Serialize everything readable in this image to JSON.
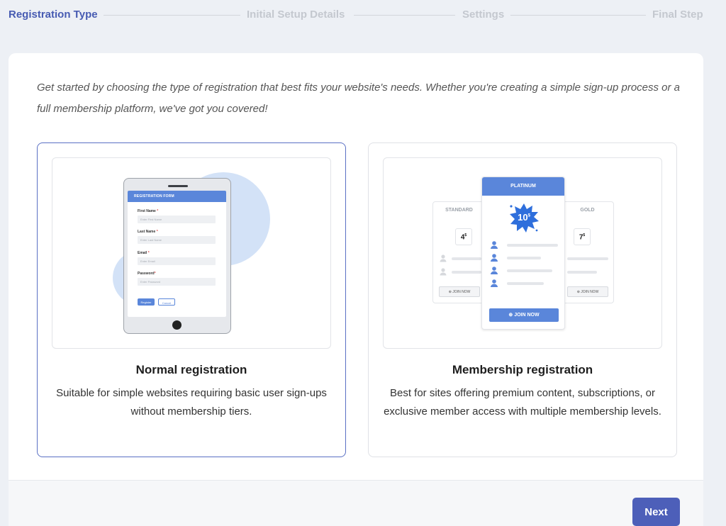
{
  "stepper": {
    "steps": [
      {
        "label": "Registration Type",
        "state": "active"
      },
      {
        "label": "Initial Setup Details",
        "state": "inactive"
      },
      {
        "label": "Settings",
        "state": "inactive"
      },
      {
        "label": "Final Step",
        "state": "inactive"
      }
    ]
  },
  "intro_text": "Get started by choosing the type of registration that best fits your website's needs. Whether you're creating a simple sign-up process or a full membership platform, we've got you covered!",
  "options": [
    {
      "title": "Normal registration",
      "description": "Suitable for simple websites requiring basic user sign-ups without membership tiers.",
      "selected": true,
      "illustration": {
        "form_title": "REGISTRATION FORM",
        "fields": [
          {
            "label": "First Name",
            "placeholder": "Enter First Name"
          },
          {
            "label": "Last Name",
            "placeholder": "Enter Last Name"
          },
          {
            "label": "Email",
            "placeholder": "Enter Email"
          },
          {
            "label": "Password",
            "placeholder": "Enter Password"
          }
        ],
        "required_mark": "*",
        "register_label": "Register",
        "cancel_label": "Cancel"
      }
    },
    {
      "title": "Membership registration",
      "description": "Best for sites offering premium content, subscriptions, or exclusive member access with multiple membership levels.",
      "selected": false,
      "illustration": {
        "plans": [
          {
            "name": "STANDARD",
            "price": "4",
            "currency": "$",
            "join_label": "JOIN NOW"
          },
          {
            "name": "PLATINUM",
            "price": "10",
            "currency": "$",
            "join_label": "JOIN NOW"
          },
          {
            "name": "GOLD",
            "price": "7",
            "currency": "$",
            "join_label": "JOIN NOW"
          }
        ]
      }
    }
  ],
  "footer": {
    "next_label": "Next"
  },
  "colors": {
    "accent": "#4d5fb9",
    "active_step": "#475bb2",
    "illustration_blue": "#5a86da",
    "inactive_step": "#c4c8cf"
  }
}
